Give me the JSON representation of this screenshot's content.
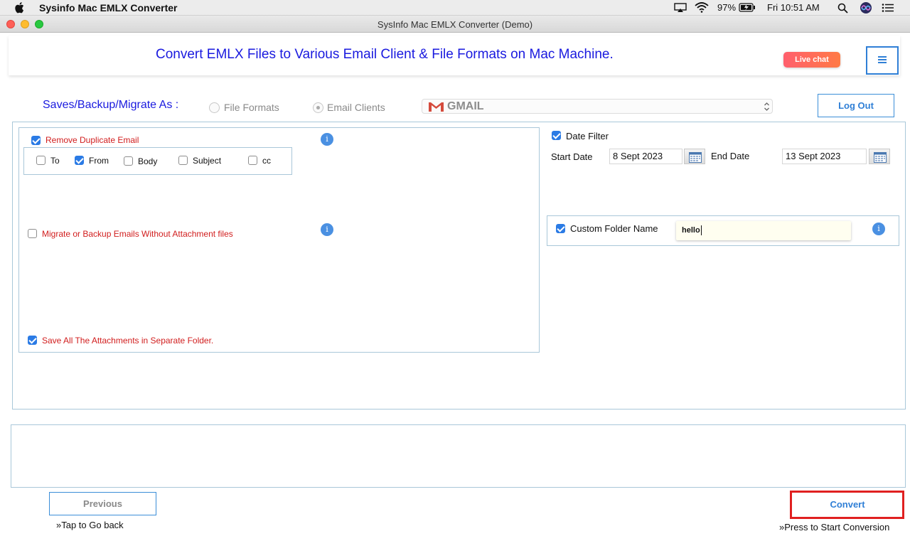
{
  "menubar": {
    "app_name": "Sysinfo Mac EMLX Converter",
    "battery": "97%",
    "clock": "Fri 10:51 AM"
  },
  "window": {
    "title": "SysInfo Mac EMLX Converter (Demo)"
  },
  "banner": {
    "headline": "Convert EMLX Files to Various Email Client & File Formats on Mac Machine.",
    "live_chat": "Live chat"
  },
  "saves": {
    "label": "Saves/Backup/Migrate As :",
    "option_file_formats": "File Formats",
    "option_email_clients": "Email Clients",
    "selected_option": "Email Clients",
    "selected_client": "GMAIL",
    "logout": "Log Out"
  },
  "left_options": {
    "remove_duplicate": {
      "label": "Remove Duplicate Email",
      "checked": true
    },
    "dup_fields": [
      {
        "label": "To",
        "checked": false
      },
      {
        "label": "From",
        "checked": true
      },
      {
        "label": "Body",
        "checked": false
      },
      {
        "label": "Subject",
        "checked": false
      },
      {
        "label": "cc",
        "checked": false
      }
    ],
    "without_attachments": {
      "label": "Migrate or Backup Emails Without Attachment files",
      "checked": false
    },
    "save_attachments": {
      "label": "Save All The Attachments in Separate Folder.",
      "checked": true
    }
  },
  "right_options": {
    "date_filter": {
      "label": "Date Filter",
      "checked": true
    },
    "start_date_label": "Start Date",
    "start_date": "8 Sept 2023",
    "end_date_label": "End Date",
    "end_date": "13 Sept 2023",
    "custom_folder": {
      "label": "Custom Folder Name",
      "checked": true,
      "value": "hello"
    }
  },
  "footer": {
    "previous": "Previous",
    "previous_hint": "»Tap to Go back",
    "convert": "Convert",
    "convert_hint": "»Press to Start Conversion"
  },
  "colors": {
    "headline": "#1a1adf",
    "accent_blue": "#2b7be5",
    "label_red": "#d11d1d",
    "highlight_box": "#e02020"
  }
}
